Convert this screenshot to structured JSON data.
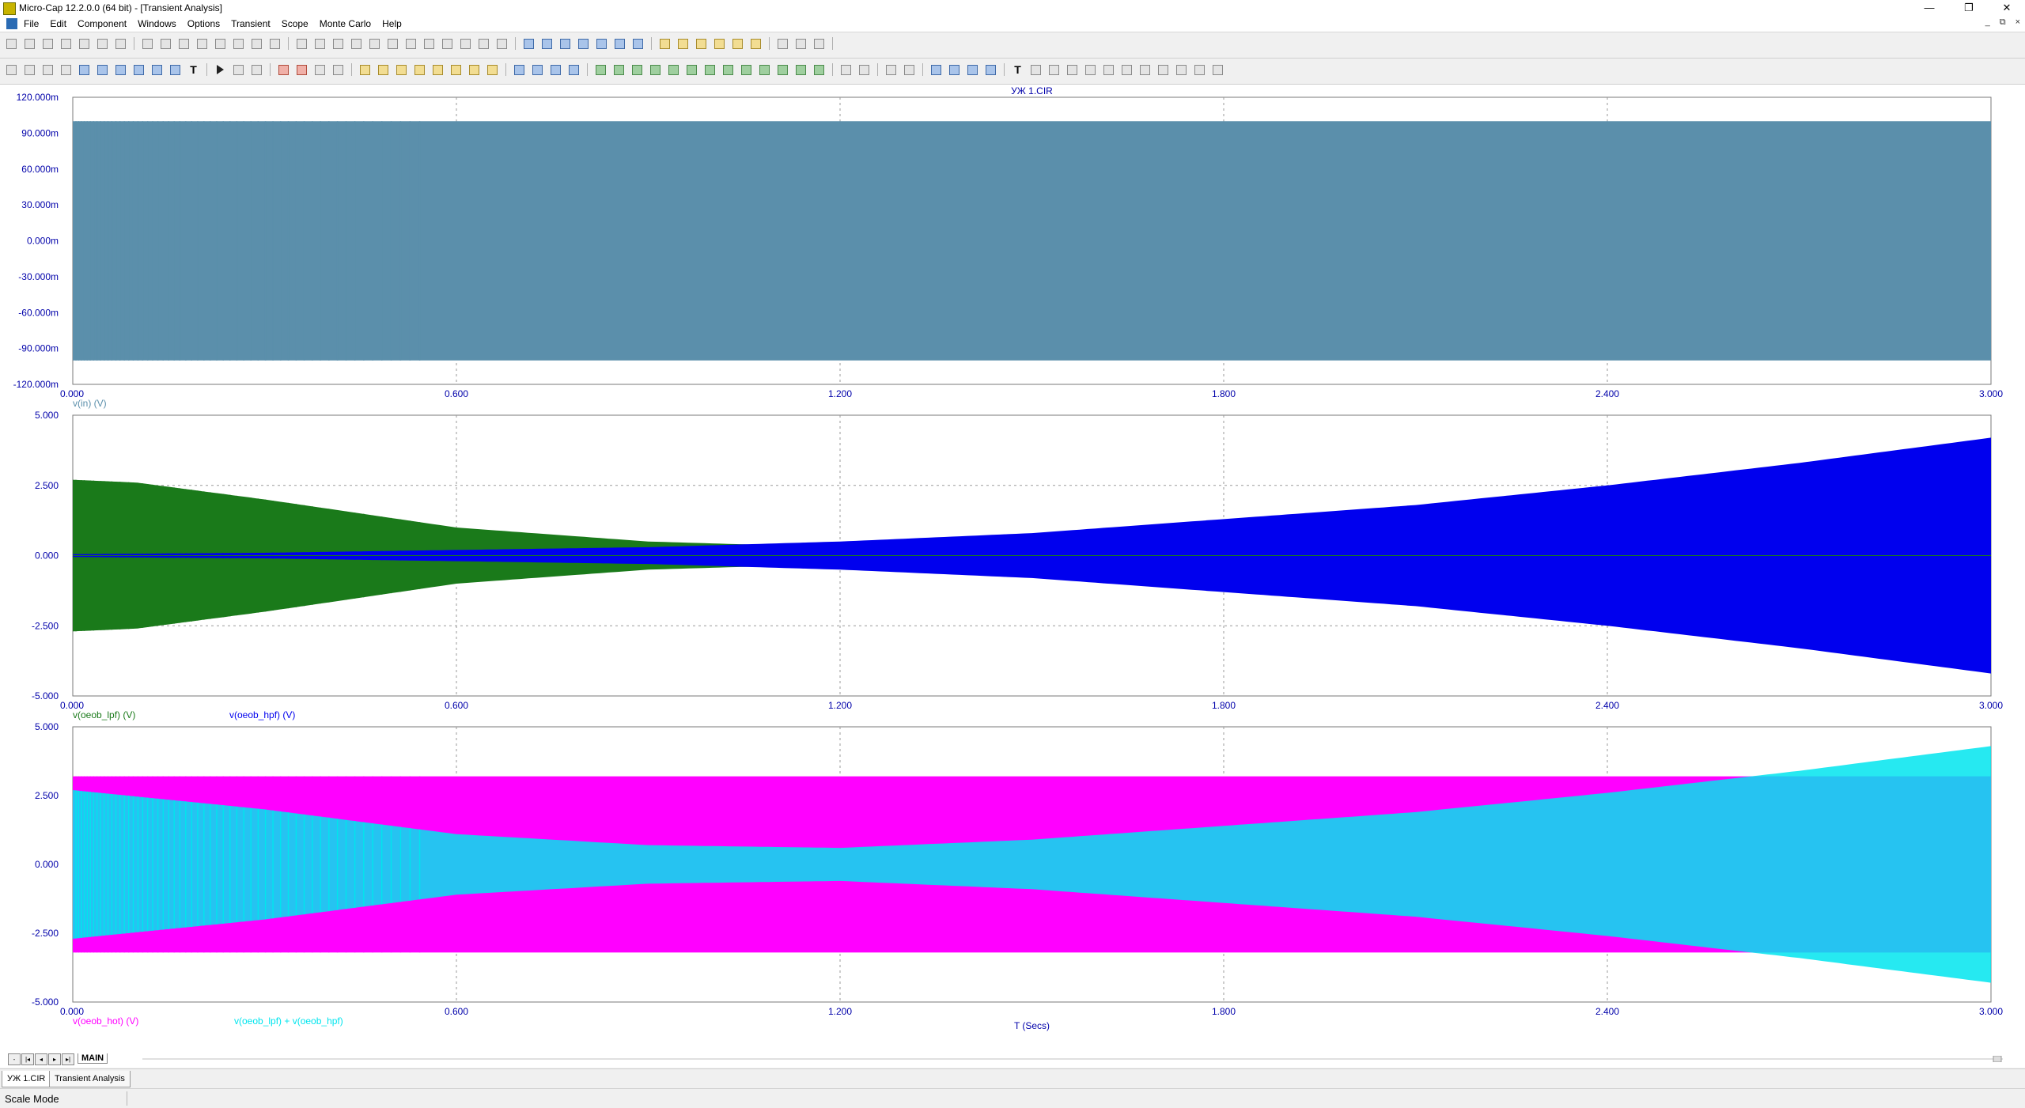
{
  "window": {
    "title": "Micro-Cap 12.2.0.0 (64 bit) - [Transient Analysis]",
    "minimize_glyph": "—",
    "restore_glyph": "❐",
    "close_glyph": "✕"
  },
  "menu": {
    "items": [
      "File",
      "Edit",
      "Component",
      "Windows",
      "Options",
      "Transient",
      "Scope",
      "Monte Carlo",
      "Help"
    ],
    "mdi_buttons": [
      "_",
      "⧉",
      "×"
    ]
  },
  "plot": {
    "title": "УЖ 1.CIR",
    "x_axis_label": "T (Secs)",
    "x_ticks": [
      "0.000",
      "0.600",
      "1.200",
      "1.800",
      "2.400",
      "3.000"
    ],
    "panels": [
      {
        "y_ticks": [
          "120.000m",
          "90.000m",
          "60.000m",
          "30.000m",
          "0.000m",
          "-30.000m",
          "-60.000m",
          "-90.000m",
          "-120.000m"
        ],
        "traces": [
          {
            "label": "v(in) (V)",
            "color": "#5b8fab"
          }
        ]
      },
      {
        "y_ticks": [
          "5.000",
          "2.500",
          "0.000",
          "-2.500",
          "-5.000"
        ],
        "traces": [
          {
            "label": "v(oeob_lpf) (V)",
            "color": "#1a7a1a"
          },
          {
            "label": "v(oeob_hpf) (V)",
            "color": "#0000ee"
          }
        ]
      },
      {
        "y_ticks": [
          "5.000",
          "2.500",
          "0.000",
          "-2.500",
          "-5.000"
        ],
        "traces": [
          {
            "label": "v(oeob_hot) (V)",
            "color": "#ff00ff"
          },
          {
            "label": "v(oeob_lpf) + v(oeob_hpf)",
            "color": "#00e5ee"
          }
        ]
      }
    ]
  },
  "chart_data": [
    {
      "type": "line",
      "title": "УЖ 1.CIR",
      "xlabel": "",
      "ylabel": "",
      "xlim": [
        0,
        3
      ],
      "ylim": [
        -0.12,
        0.12
      ],
      "series": [
        {
          "name": "v(in) (V)",
          "x": [
            0,
            0.1,
            0.3,
            0.6,
            1.2,
            1.8,
            2.4,
            3.0
          ],
          "amplitude": [
            0.1,
            0.1,
            0.1,
            0.1,
            0.1,
            0.1,
            0.1,
            0.1
          ]
        }
      ]
    },
    {
      "type": "line",
      "xlim": [
        0,
        3
      ],
      "ylim": [
        -5,
        5
      ],
      "series": [
        {
          "name": "v(oeob_lpf) (V)",
          "x": [
            0,
            0.1,
            0.3,
            0.6,
            0.9,
            1.2,
            1.8,
            2.4,
            3.0
          ],
          "amplitude": [
            2.7,
            2.6,
            2.0,
            1.0,
            0.5,
            0.3,
            0.1,
            0.05,
            0.02
          ]
        },
        {
          "name": "v(oeob_hpf) (V)",
          "x": [
            0,
            0.3,
            0.6,
            0.9,
            1.2,
            1.5,
            1.8,
            2.1,
            2.4,
            2.7,
            3.0
          ],
          "amplitude": [
            0.05,
            0.1,
            0.2,
            0.3,
            0.5,
            0.8,
            1.3,
            1.8,
            2.5,
            3.3,
            4.2
          ]
        }
      ]
    },
    {
      "type": "line",
      "xlim": [
        0,
        3
      ],
      "ylim": [
        -5,
        5
      ],
      "series": [
        {
          "name": "v(oeob_hot) (V)",
          "x": [
            0,
            0.3,
            0.6,
            1.2,
            1.8,
            2.4,
            3.0
          ],
          "amplitude": [
            3.2,
            3.2,
            3.2,
            3.2,
            3.2,
            3.2,
            3.2
          ]
        },
        {
          "name": "v(oeob_lpf) + v(oeob_hpf)",
          "x": [
            0,
            0.3,
            0.6,
            0.9,
            1.2,
            1.5,
            1.8,
            2.1,
            2.4,
            2.7,
            3.0
          ],
          "amplitude": [
            2.7,
            2.0,
            1.1,
            0.7,
            0.6,
            0.9,
            1.4,
            1.9,
            2.6,
            3.4,
            4.3
          ]
        }
      ]
    }
  ],
  "bottom": {
    "main_tab": "MAIN",
    "nav": [
      "-",
      "|◂",
      "◂",
      "▸",
      "▸|"
    ]
  },
  "tabs": [
    "УЖ 1.CIR",
    "Transient Analysis"
  ],
  "status": {
    "text": "Scale Mode"
  }
}
